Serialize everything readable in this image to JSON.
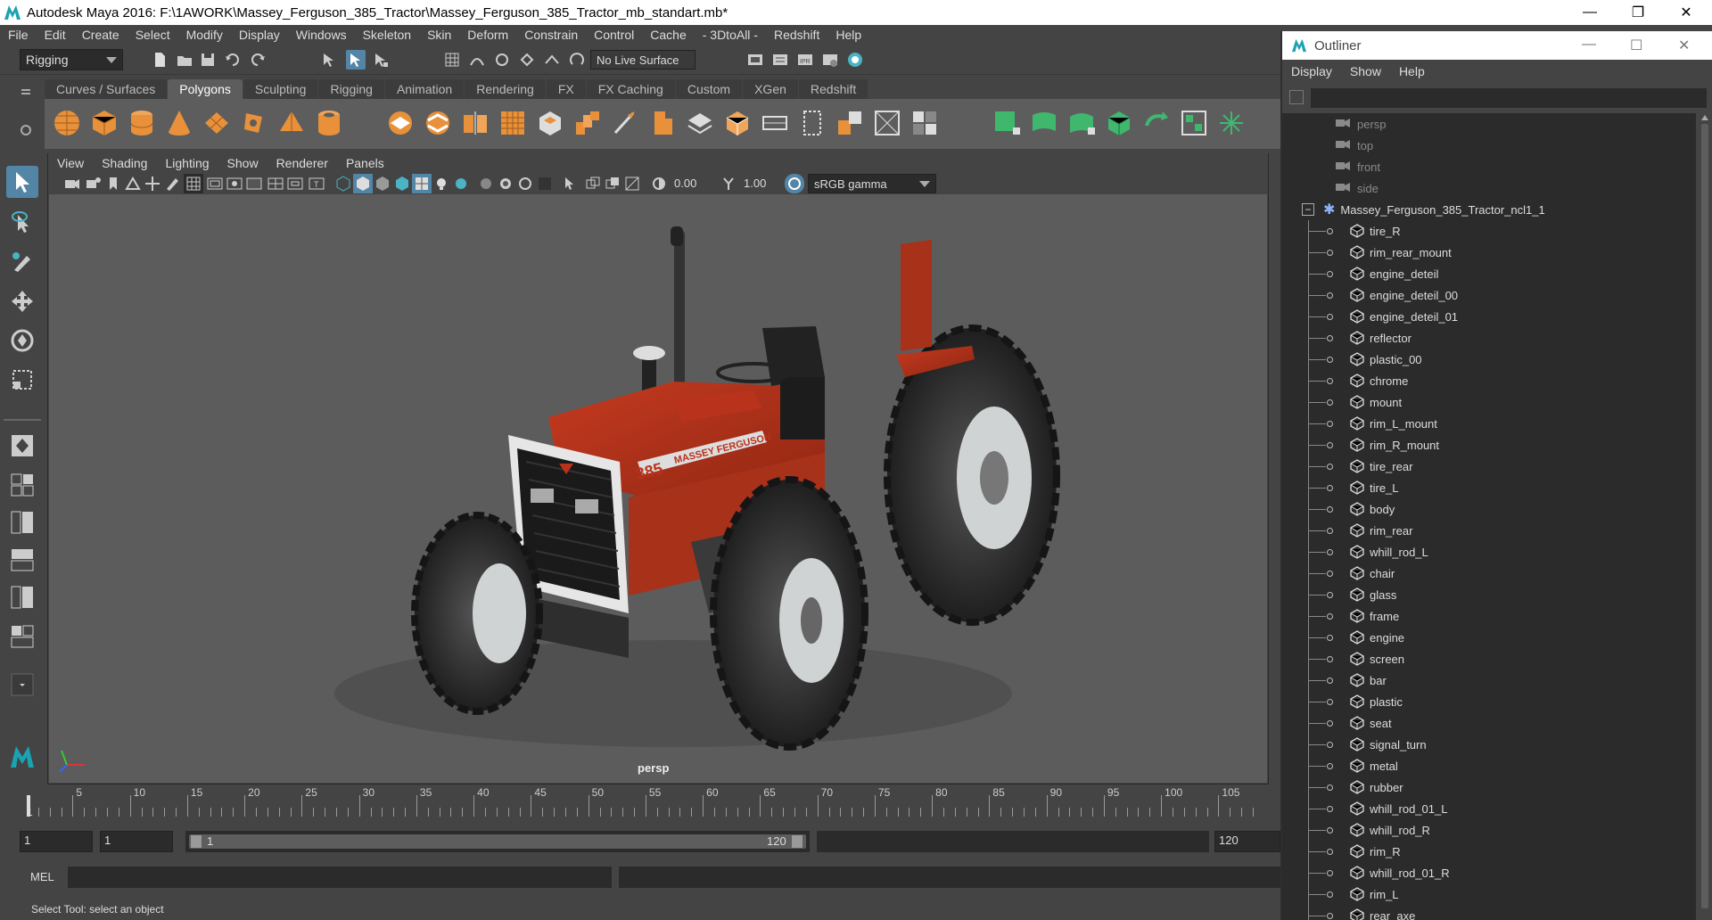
{
  "window": {
    "title": "Autodesk Maya 2016: F:\\1AWORK\\Massey_Ferguson_385_Tractor\\Massey_Ferguson_385_Tractor_mb_standart.mb*"
  },
  "menubar": [
    "File",
    "Edit",
    "Create",
    "Select",
    "Modify",
    "Display",
    "Windows",
    "Skeleton",
    "Skin",
    "Deform",
    "Constrain",
    "Control",
    "Cache",
    "- 3DtoAll -",
    "Redshift",
    "Help"
  ],
  "statusline": {
    "mode": "Rigging",
    "live_surface": "No Live Surface"
  },
  "shelf_tabs": [
    "Curves / Surfaces",
    "Polygons",
    "Sculpting",
    "Rigging",
    "Animation",
    "Rendering",
    "FX",
    "FX Caching",
    "Custom",
    "XGen",
    "Redshift"
  ],
  "shelf_active": "Polygons",
  "panel_menu": [
    "View",
    "Shading",
    "Lighting",
    "Show",
    "Renderer",
    "Panels"
  ],
  "panel_toolbar": {
    "exposure": "0.00",
    "gamma": "1.00",
    "color_space": "sRGB gamma"
  },
  "viewport": {
    "camera_label": "persp",
    "brand_text": "MASSEY FERGUSON",
    "model_number": "385"
  },
  "timeline": {
    "ticks": [
      "5",
      "10",
      "15",
      "20",
      "25",
      "30",
      "35",
      "40",
      "45",
      "50",
      "55",
      "60",
      "65",
      "70",
      "75",
      "80",
      "85",
      "90",
      "95",
      "100",
      "105"
    ],
    "current_frame": "1"
  },
  "range": {
    "start": "1",
    "playback_start": "1",
    "range_start": "1",
    "range_end": "120",
    "end": "120"
  },
  "cmdline": {
    "lang": "MEL"
  },
  "helpline": "Select Tool: select an object",
  "outliner": {
    "title": "Outliner",
    "menu": [
      "Display",
      "Show",
      "Help"
    ],
    "cameras": [
      "persp",
      "top",
      "front",
      "side"
    ],
    "group": "Massey_Ferguson_385_Tractor_ncl1_1",
    "children": [
      "tire_R",
      "rim_rear_mount",
      "engine_deteil",
      "engine_deteil_00",
      "engine_deteil_01",
      "reflector",
      "plastic_00",
      "chrome",
      "mount",
      "rim_L_mount",
      "rim_R_mount",
      "tire_rear",
      "tire_L",
      "body",
      "rim_rear",
      "whill_rod_L",
      "chair",
      "glass",
      "frame",
      "engine",
      "screen",
      "bar",
      "plastic",
      "seat",
      "signal_turn",
      "metal",
      "rubber",
      "whill_rod_01_L",
      "whill_rod_R",
      "rim_R",
      "whill_rod_01_R",
      "rim_L",
      "rear_axe"
    ]
  },
  "colors": {
    "ui_bg": "#444444",
    "viewport_bg": "#5c5c5c",
    "shelf_bg": "#5d5d5d",
    "accent_blue": "#5285a6",
    "tractor_red": "#b8321c"
  }
}
